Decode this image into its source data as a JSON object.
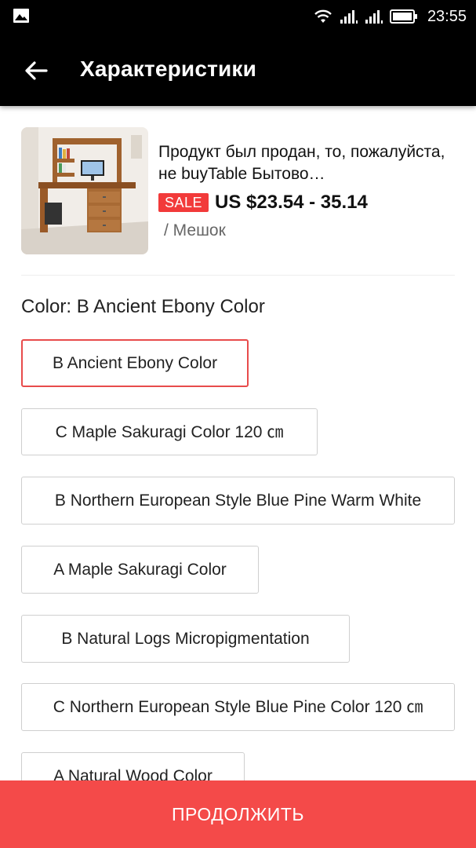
{
  "status_bar": {
    "time": "23:55"
  },
  "header": {
    "title": "Характеристики"
  },
  "product": {
    "title": "Продукт был продан, то, пожалуйста, не buyTable Бытово…",
    "sale_badge": "SALE",
    "price": "US $23.54 - 35.14",
    "unit": "/ Мешок"
  },
  "color": {
    "label": "Color: B  Ancient Ebony Color",
    "options": [
      {
        "label": "B  Ancient Ebony Color",
        "selected": true
      },
      {
        "label": "C  Maple Sakuragi Color 120 ㎝",
        "selected": false
      },
      {
        "label": "B  Northern European Style Blue Pine   Warm White",
        "selected": false
      },
      {
        "label": "A  Maple Sakuragi Color",
        "selected": false
      },
      {
        "label": "B  Natural Logs Micropigmentation",
        "selected": false
      },
      {
        "label": "C  Northern European Style Blue Pine Color 120 ㎝",
        "selected": false
      },
      {
        "label": "A  Natural Wood Color",
        "selected": false
      }
    ]
  },
  "footer": {
    "continue_label": "ПРОДОЛЖИТЬ"
  },
  "colors": {
    "accent": "#f44a49",
    "selected_border": "#e84b4b",
    "sale_badge": "#f23a3a"
  }
}
